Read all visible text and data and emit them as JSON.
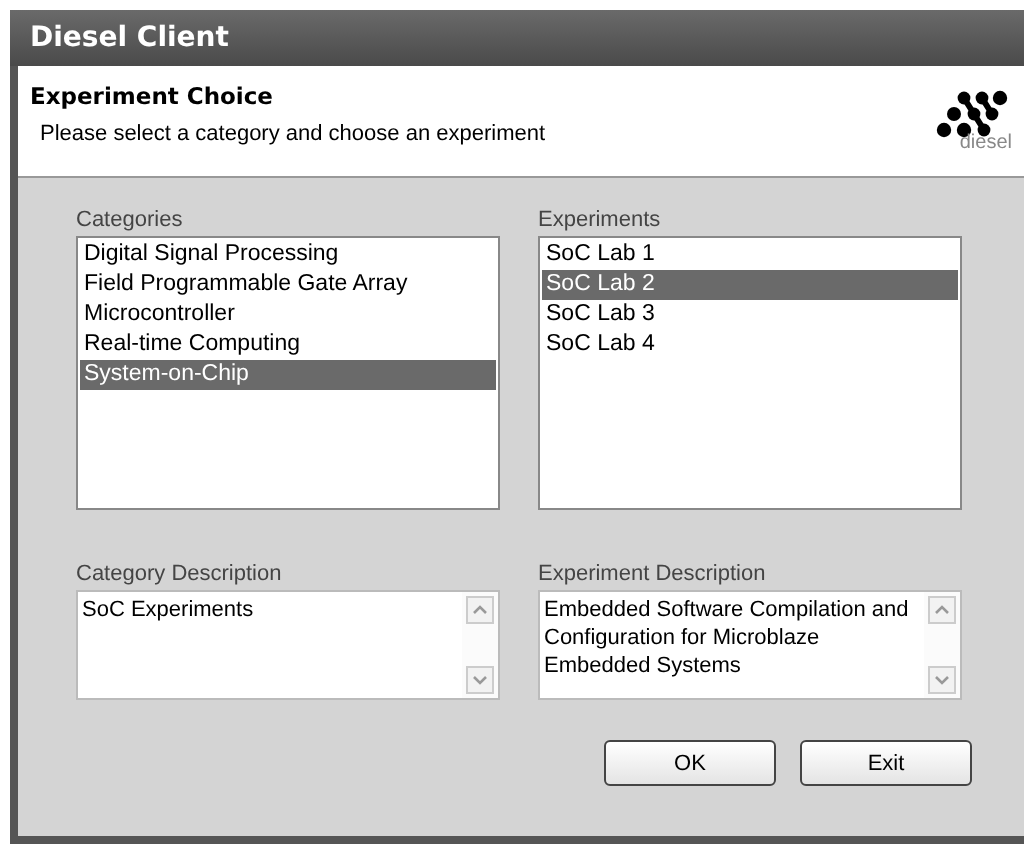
{
  "window": {
    "title": "Diesel Client"
  },
  "header": {
    "title": "Experiment Choice",
    "subtitle": "Please select a category and choose an experiment",
    "logo_text": "diesel"
  },
  "categories": {
    "label": "Categories",
    "items": [
      {
        "label": "Digital Signal Processing",
        "selected": false
      },
      {
        "label": "Field Programmable Gate Array",
        "selected": false
      },
      {
        "label": "Microcontroller",
        "selected": false
      },
      {
        "label": "Real-time Computing",
        "selected": false
      },
      {
        "label": "System-on-Chip",
        "selected": true
      }
    ]
  },
  "experiments": {
    "label": "Experiments",
    "items": [
      {
        "label": "SoC Lab 1",
        "selected": false
      },
      {
        "label": "SoC Lab 2",
        "selected": true
      },
      {
        "label": "SoC Lab 3",
        "selected": false
      },
      {
        "label": "SoC Lab 4",
        "selected": false
      }
    ]
  },
  "category_description": {
    "label": "Category Description",
    "text": "SoC Experiments"
  },
  "experiment_description": {
    "label": "Experiment Description",
    "text": "Embedded Software Compilation and Configuration for Microblaze Embedded Systems"
  },
  "buttons": [
    "OK",
    "Exit"
  ]
}
